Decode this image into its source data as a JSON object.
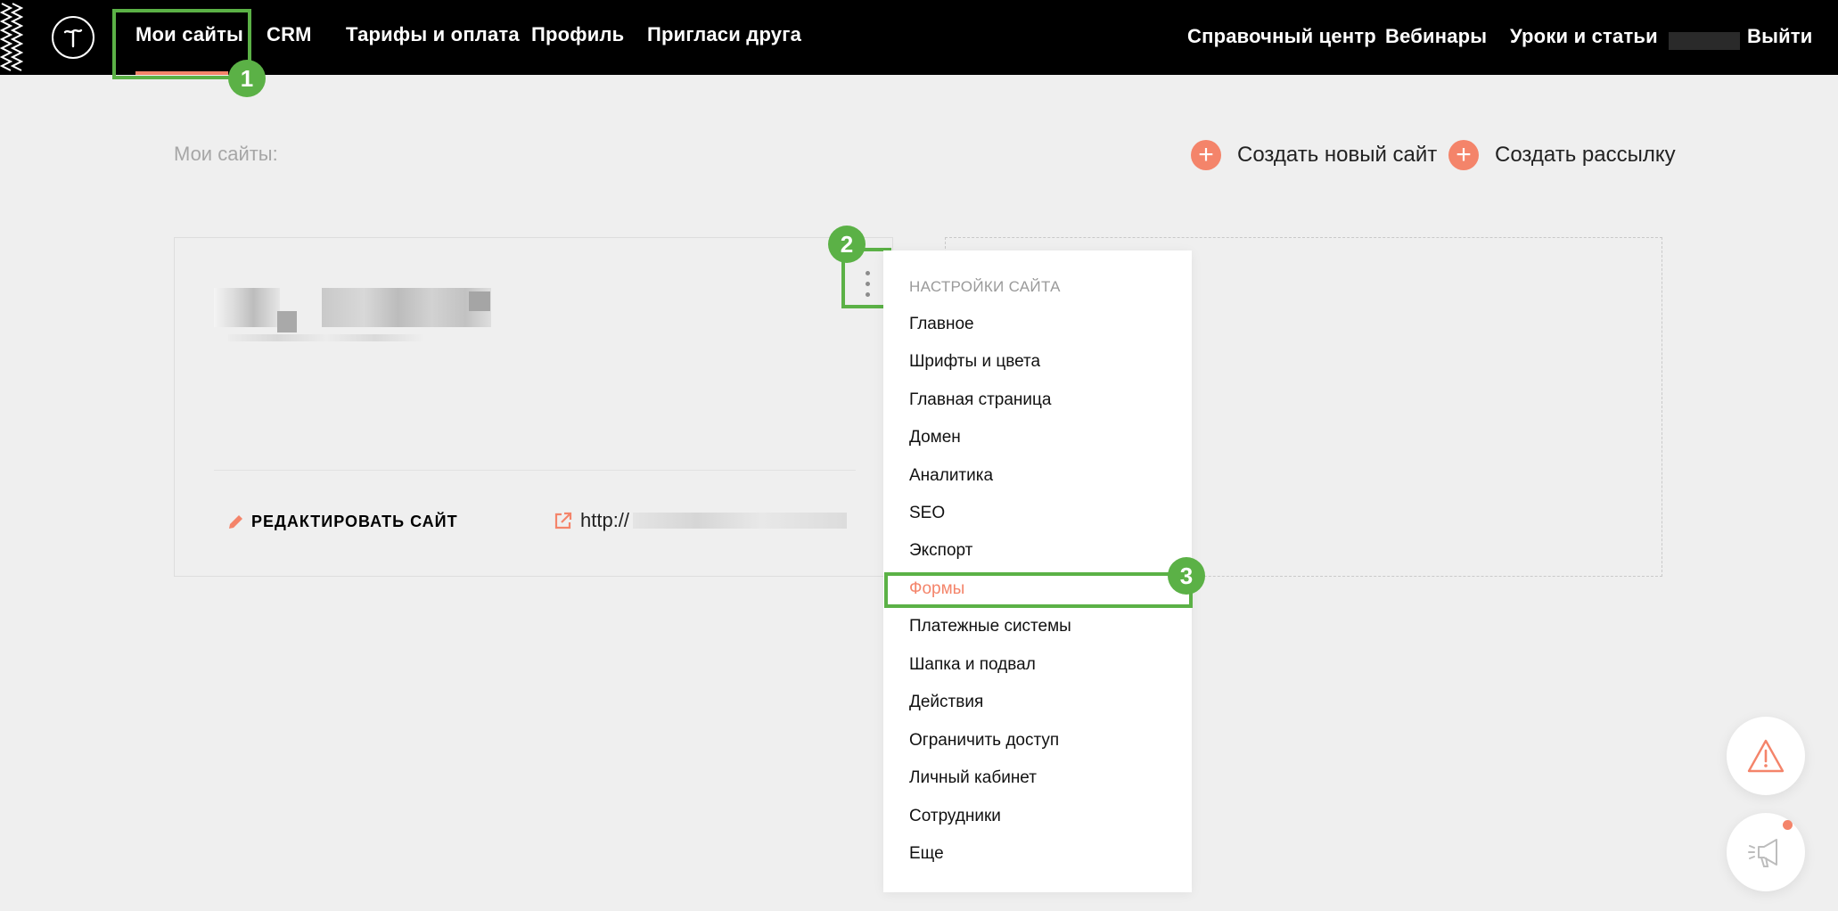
{
  "nav": {
    "left": [
      "Мои сайты",
      "CRM",
      "Тарифы и оплата",
      "Профиль",
      "Пригласи друга"
    ],
    "right": [
      "Справочный центр",
      "Вебинары",
      "Уроки и статьи",
      "Выйти"
    ]
  },
  "page": {
    "title": "Мои сайты:",
    "create_site": "Создать новый сайт",
    "create_mailing": "Создать рассылку"
  },
  "site_card": {
    "edit_label": "РЕДАКТИРОВАТЬ САЙТ",
    "url_prefix": "http://"
  },
  "menu": {
    "header": "НАСТРОЙКИ САЙТА",
    "items": [
      "Главное",
      "Шрифты и цвета",
      "Главная страница",
      "Домен",
      "Аналитика",
      "SEO",
      "Экспорт",
      "Формы",
      "Платежные системы",
      "Шапка и подвал",
      "Действия",
      "Ограничить доступ",
      "Личный кабинет",
      "Сотрудники",
      "Еще"
    ],
    "active_item": "Формы"
  },
  "annotations": [
    "1",
    "2",
    "3"
  ],
  "colors": {
    "accent": "#f4846a",
    "highlight": "#5bb146",
    "topbar": "#000000",
    "background": "#efefef"
  },
  "icons": {
    "logo": "tilda-logo-icon",
    "plus": "plus-icon",
    "edit": "pencil-icon",
    "external": "external-link-icon",
    "more": "vertical-dots-icon",
    "warning": "warning-icon",
    "announce": "megaphone-icon"
  }
}
